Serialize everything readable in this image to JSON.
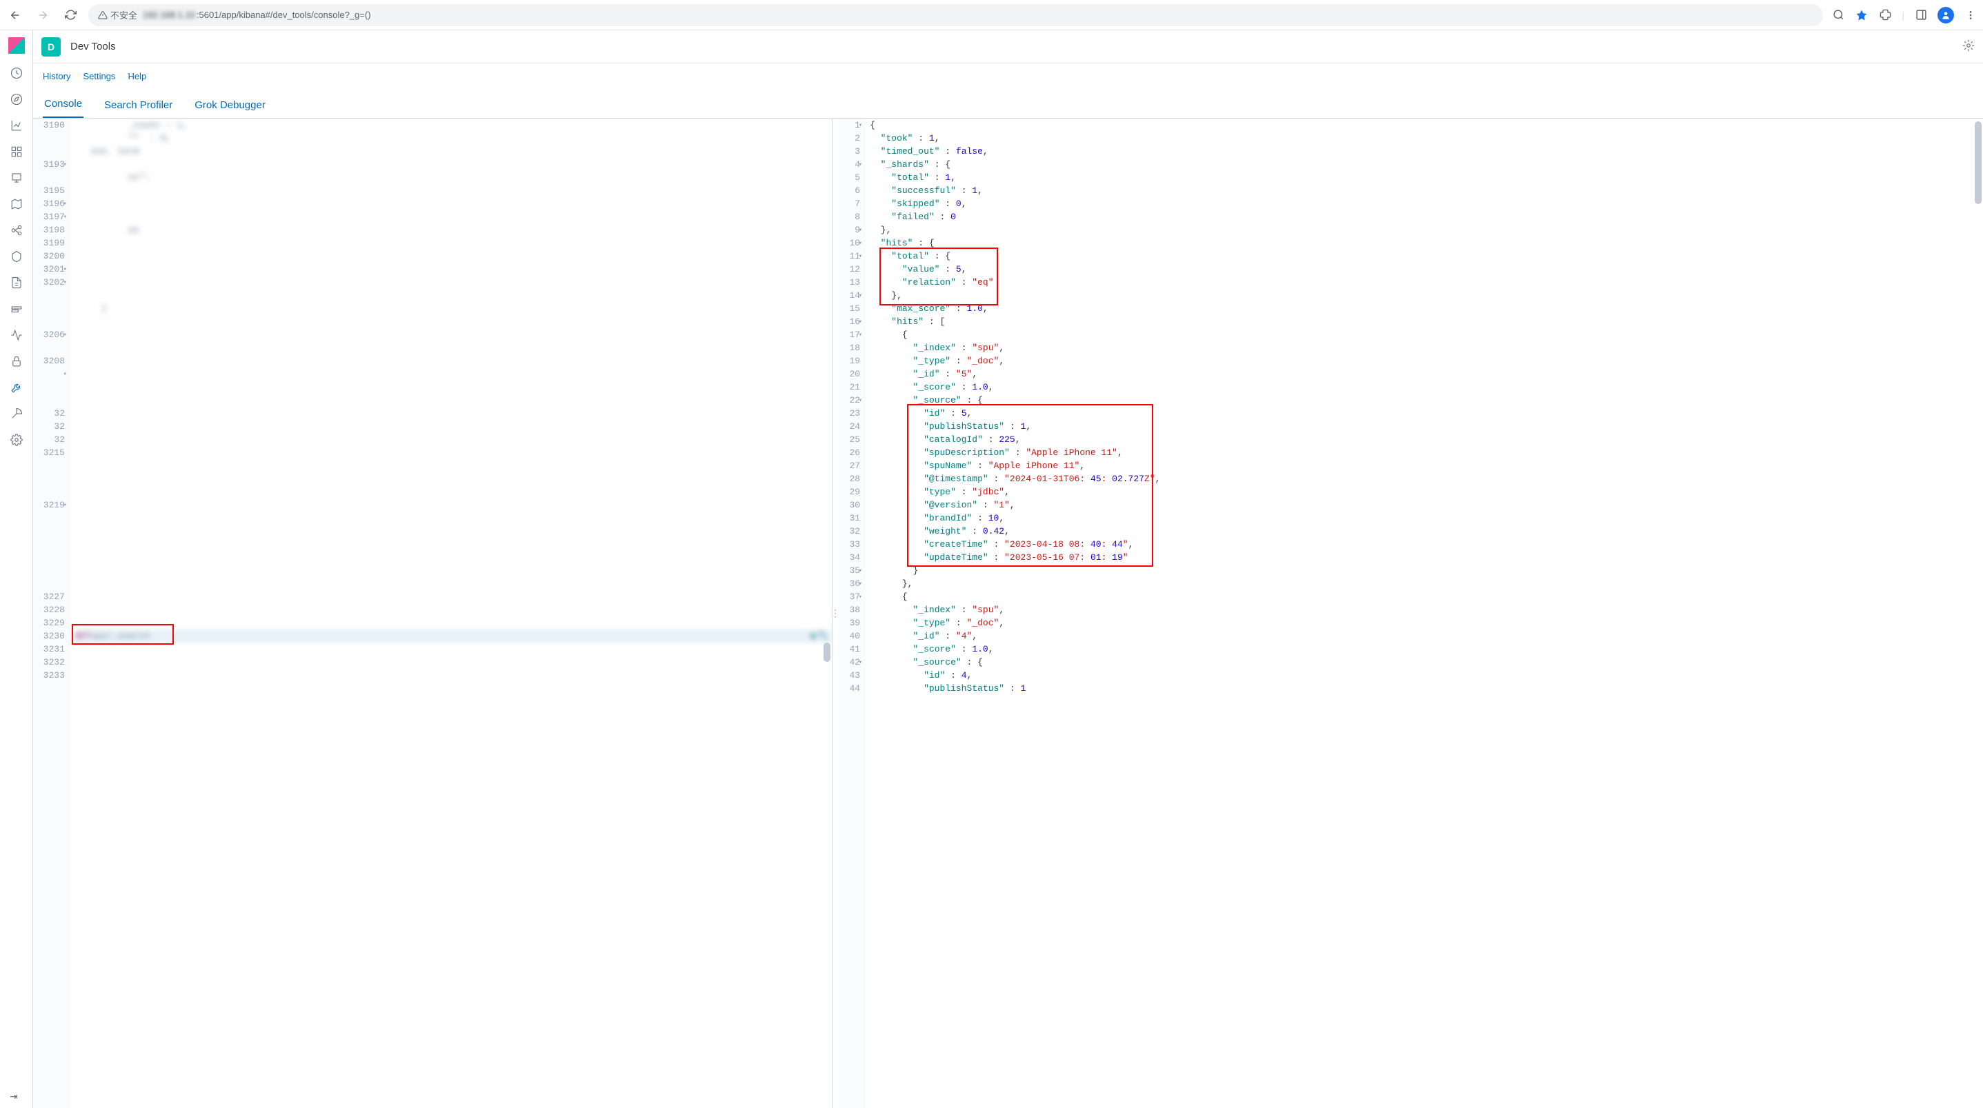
{
  "browser": {
    "security_label": "不安全",
    "url_suffix": ":5601/app/kibana#/dev_tools/console?_g=()"
  },
  "header": {
    "space_letter": "D",
    "app_title": "Dev Tools"
  },
  "links": {
    "history": "History",
    "settings": "Settings",
    "help": "Help"
  },
  "tabs": {
    "console": "Console",
    "profiler": "Search Profiler",
    "grok": "Grok Debugger"
  },
  "req": {
    "method": "GET",
    "path": "spu/_search",
    "gutter_lines": [
      "3190",
      "",
      "",
      "3193",
      "",
      "3195",
      "3196",
      "3197",
      "3198",
      "3199",
      "3200",
      "3201",
      "3202",
      "",
      "",
      "",
      "3206",
      "",
      "3208",
      "",
      "",
      "",
      "32",
      "32",
      "32",
      "3215",
      "",
      "",
      "",
      "3219",
      "",
      "",
      "",
      "",
      "",
      "",
      "3227",
      "3228",
      "3229",
      "3230",
      "3231",
      "3232",
      "3233"
    ],
    "gutter_fold_at": [
      3,
      6,
      7,
      11,
      12,
      16,
      19,
      29
    ],
    "blurred_snippets": [
      "_count : 1,",
      "sno. term",
      "nt\":",
      "as",
      "}",
      "}"
    ]
  },
  "resp": {
    "lines": [
      "{",
      "  \"took\" : 1,",
      "  \"timed_out\" : false,",
      "  \"_shards\" : {",
      "    \"total\" : 1,",
      "    \"successful\" : 1,",
      "    \"skipped\" : 0,",
      "    \"failed\" : 0",
      "  },",
      "  \"hits\" : {",
      "    \"total\" : {",
      "      \"value\" : 5,",
      "      \"relation\" : \"eq\"",
      "    },",
      "    \"max_score\" : 1.0,",
      "    \"hits\" : [",
      "      {",
      "        \"_index\" : \"spu\",",
      "        \"_type\" : \"_doc\",",
      "        \"_id\" : \"5\",",
      "        \"_score\" : 1.0,",
      "        \"_source\" : {",
      "          \"id\" : 5,",
      "          \"publishStatus\" : 1,",
      "          \"catalogId\" : 225,",
      "          \"spuDescription\" : \"Apple iPhone 11\",",
      "          \"spuName\" : \"Apple iPhone 11\",",
      "          \"@timestamp\" : \"2024-01-31T06:45:02.727Z\",",
      "          \"type\" : \"jdbc\",",
      "          \"@version\" : \"1\",",
      "          \"brandId\" : 10,",
      "          \"weight\" : 0.42,",
      "          \"createTime\" : \"2023-04-18 08:40:44\",",
      "          \"updateTime\" : \"2023-05-16 07:01:19\"",
      "        }",
      "      },",
      "      {",
      "        \"_index\" : \"spu\",",
      "        \"_type\" : \"_doc\",",
      "        \"_id\" : \"4\",",
      "        \"_score\" : 1.0,",
      "        \"_source\" : {",
      "          \"id\" : 4,",
      "          \"publishStatus\" : 1"
    ],
    "fold_lines": [
      1,
      4,
      9,
      10,
      11,
      14,
      16,
      17,
      22,
      35,
      36,
      37,
      42
    ]
  }
}
